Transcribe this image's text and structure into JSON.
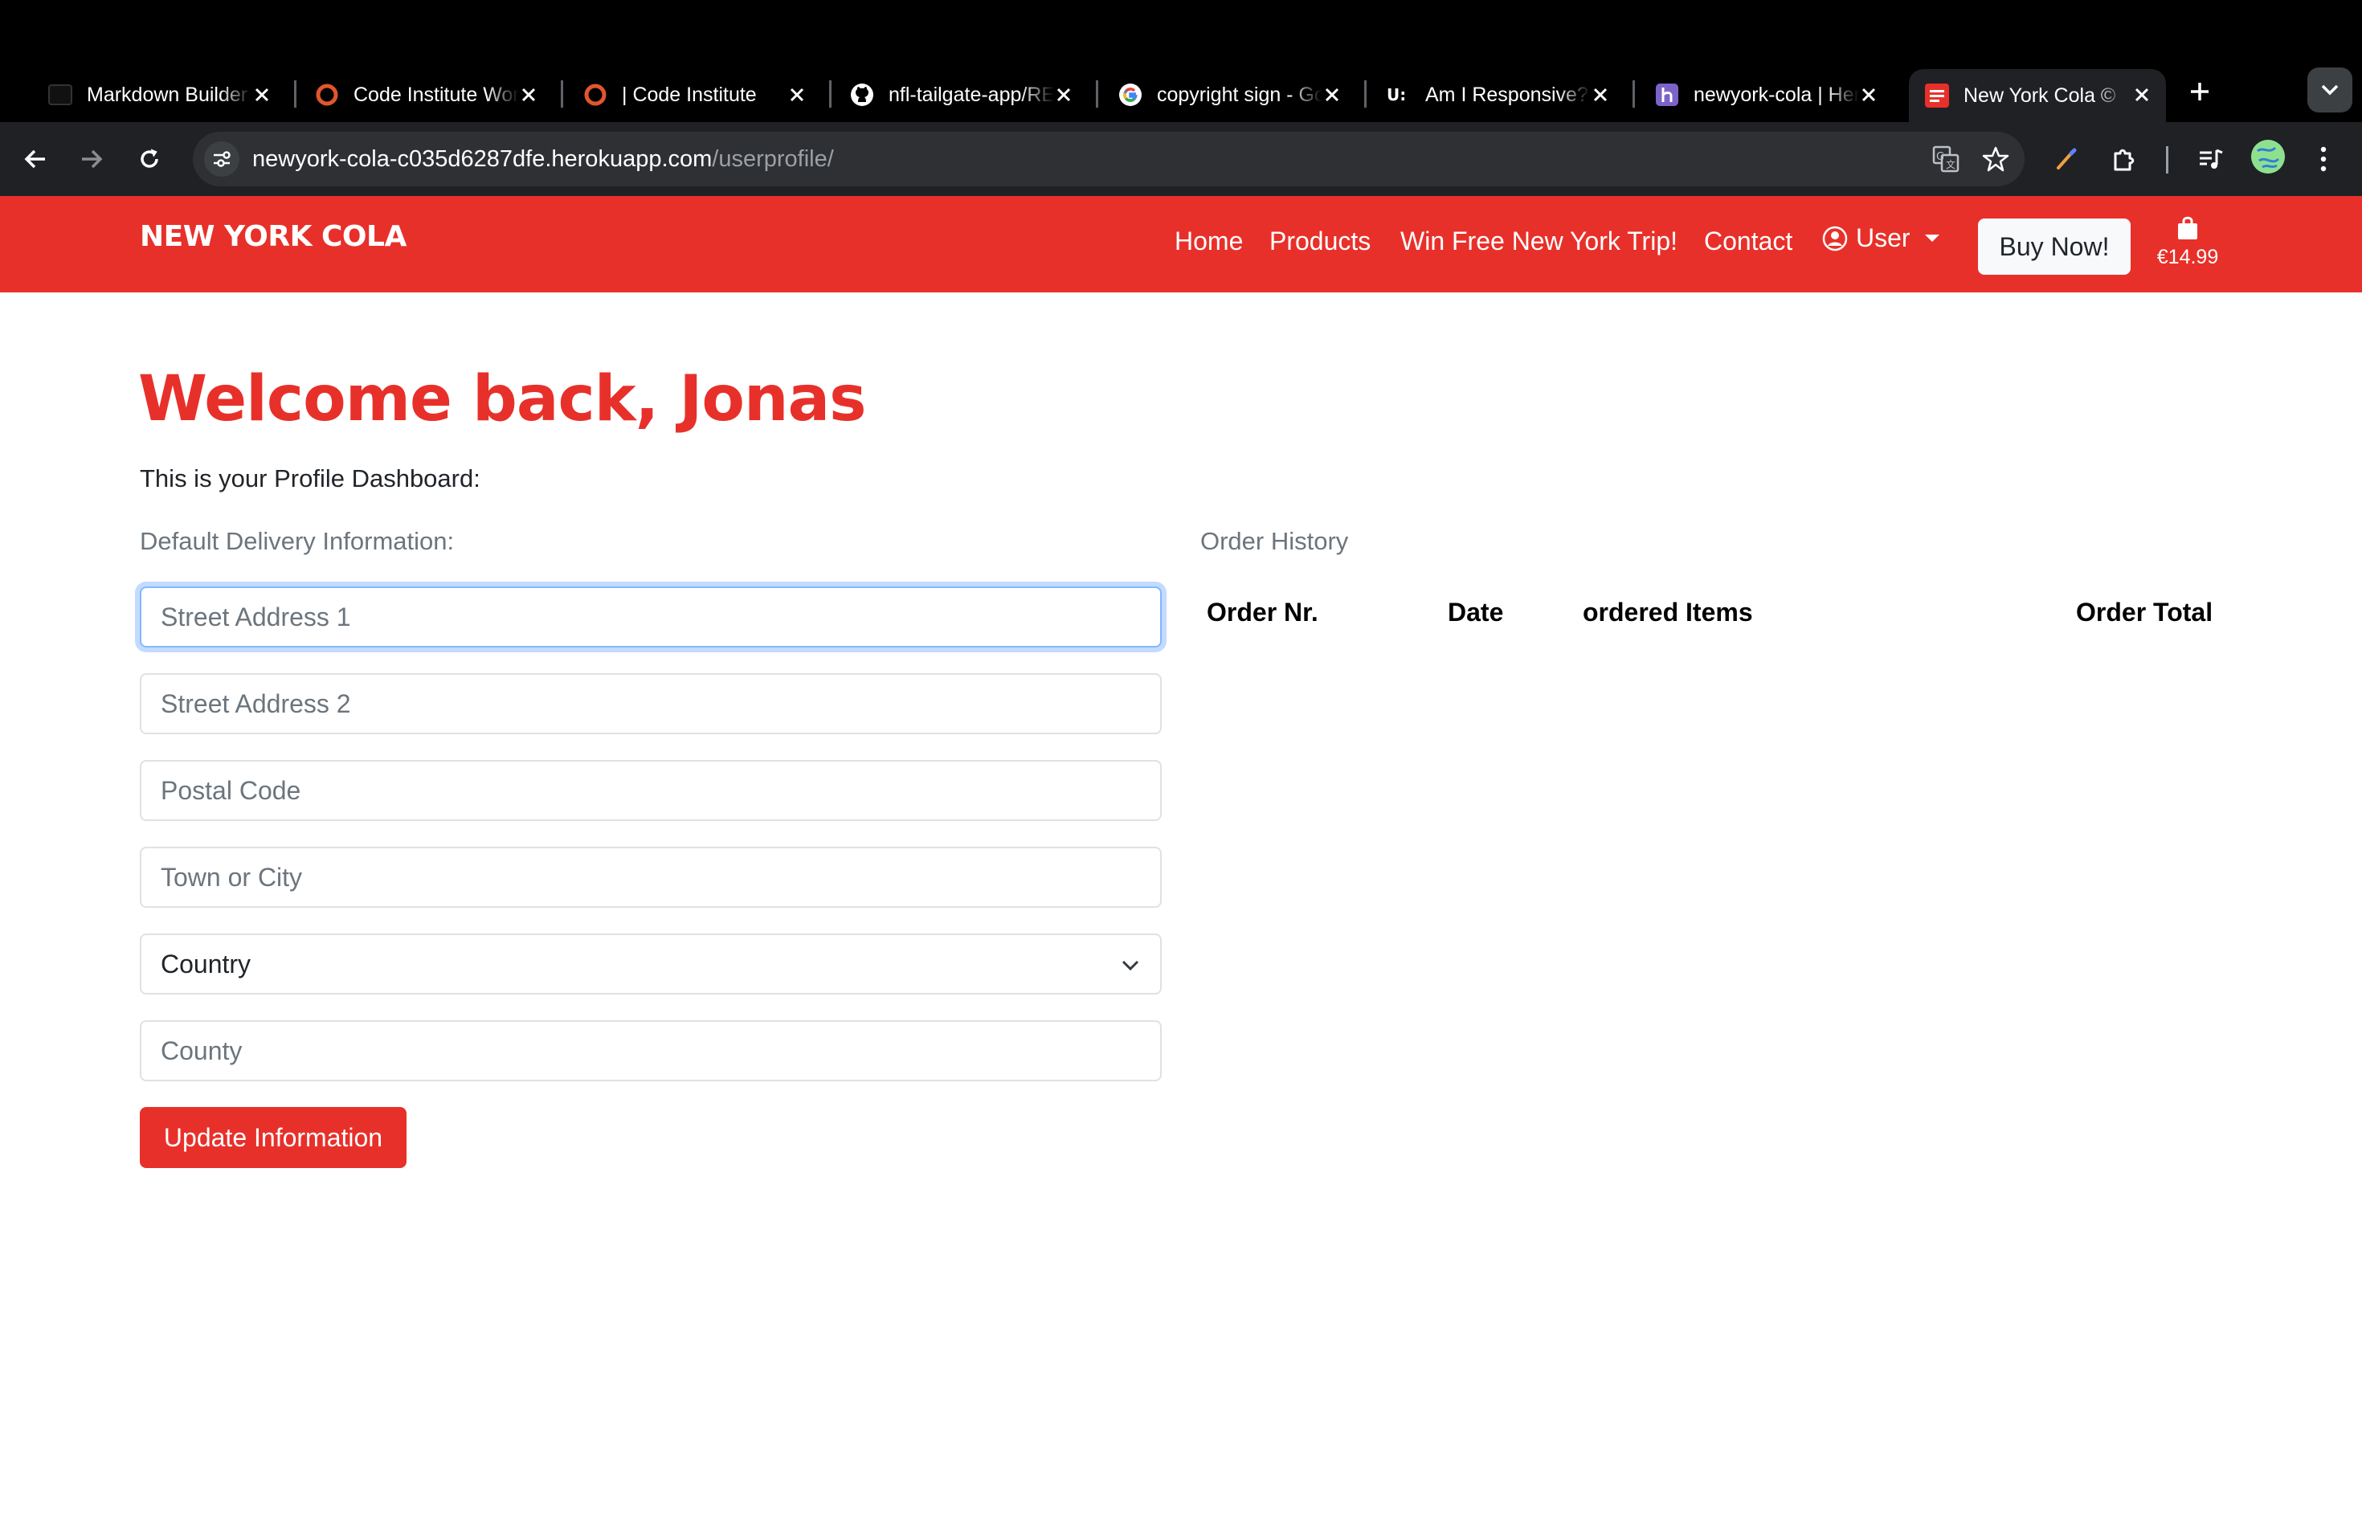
{
  "browser": {
    "tabs": [
      {
        "title": "Markdown Builder",
        "favicon": "markdown-favicon"
      },
      {
        "title": "Code Institute Workspace",
        "favicon": "code-institute-favicon"
      },
      {
        "title": "| Code Institute",
        "favicon": "code-institute-favicon"
      },
      {
        "title": "nfl-tailgate-app/README",
        "favicon": "github-favicon"
      },
      {
        "title": "copyright sign - Google",
        "favicon": "google-favicon"
      },
      {
        "title": "Am I Responsive?",
        "favicon": "amiresponsive-favicon"
      },
      {
        "title": "newyork-cola | Heroku",
        "favicon": "heroku-favicon"
      },
      {
        "title": "New York Cola ©",
        "favicon": "newyork-cola-favicon",
        "active": true
      }
    ],
    "url": {
      "host": "newyork-cola-c035d6287dfe.herokuapp.com",
      "path": "/userprofile/"
    }
  },
  "site": {
    "brand": "NEW YORK COLA",
    "nav": {
      "home": "Home",
      "products": "Products",
      "trip": "Win Free New York Trip!",
      "contact": "Contact",
      "user": "User"
    },
    "buy_button": "Buy Now!",
    "cart_total": "€14.99",
    "colors": {
      "brand_red": "#e8302a",
      "focus_blue": "#86b7fe"
    }
  },
  "profile": {
    "welcome": "Welcome back, Jonas",
    "dashboard_text": "This is your Profile Dashboard:",
    "delivery_label": "Default Delivery Information:",
    "fields": {
      "street1": "Street Address 1",
      "street2": "Street Address 2",
      "postal": "Postal Code",
      "town": "Town or City",
      "country": "Country",
      "county": "County"
    },
    "update_button": "Update Information",
    "order_history": {
      "label": "Order History",
      "columns": [
        "Order Nr.",
        "Date",
        "ordered Items",
        "Order Total"
      ]
    }
  }
}
